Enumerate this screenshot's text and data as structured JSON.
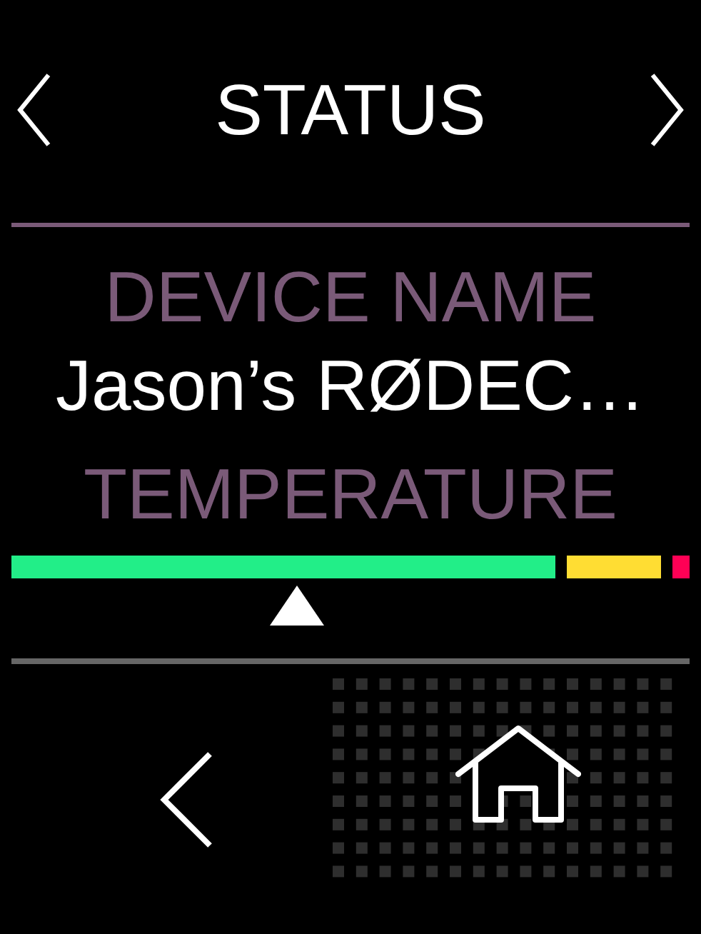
{
  "header": {
    "title": "STATUS"
  },
  "fields": [
    {
      "label": "DEVICE NAME",
      "value": "Jason’s RØDEC…"
    },
    {
      "label": "TEMPERATURE"
    }
  ]
}
